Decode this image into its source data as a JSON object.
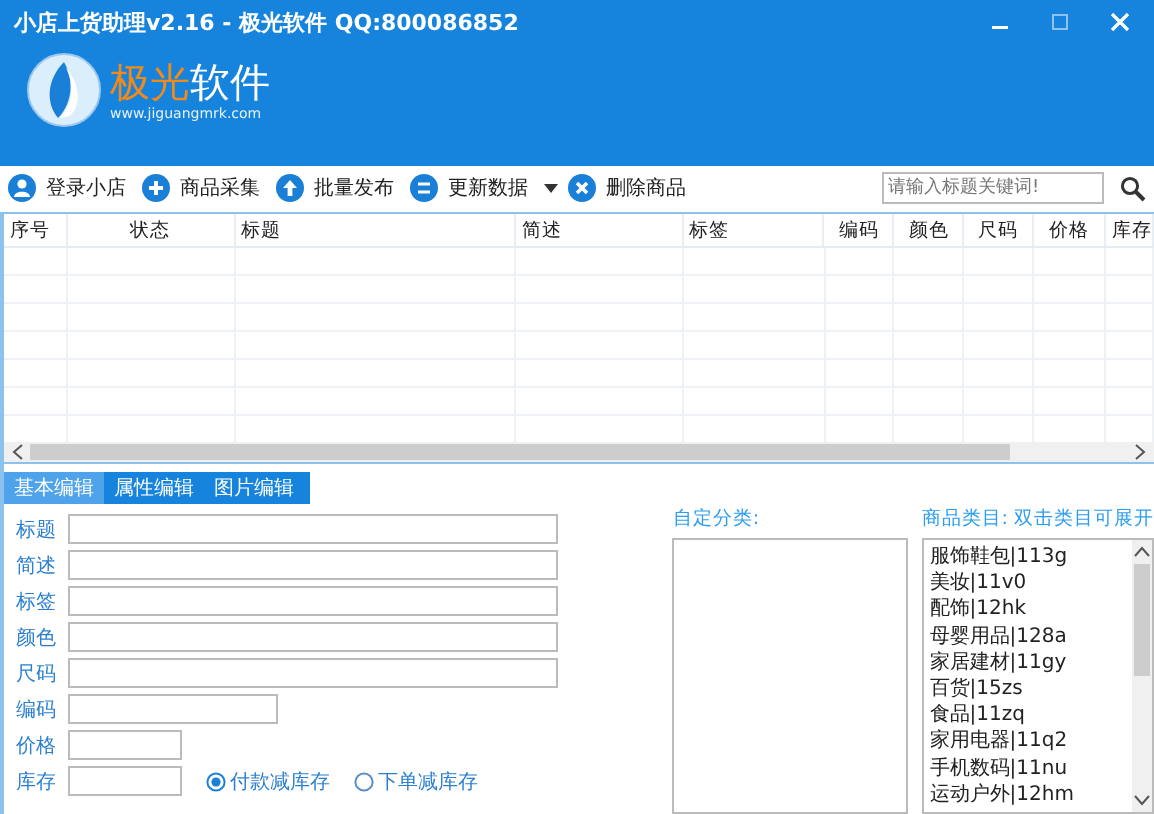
{
  "window": {
    "title": "小店上货助理v2.16 - 极光软件 QQ:800086852"
  },
  "logo": {
    "name_part1": "极光",
    "name_part2": "软件",
    "url": "www.jiguangmrk.com"
  },
  "toolbar": {
    "buttons": [
      {
        "label": "登录小店",
        "dropdown": false
      },
      {
        "label": "商品采集",
        "dropdown": false
      },
      {
        "label": "批量发布",
        "dropdown": false
      },
      {
        "label": "更新数据",
        "dropdown": true
      },
      {
        "label": "删除商品",
        "dropdown": false
      }
    ],
    "search": {
      "placeholder": "请输入标题关键词!"
    }
  },
  "table": {
    "columns": [
      "序号",
      "状态",
      "标题",
      "简述",
      "标签",
      "编码",
      "颜色",
      "尺码",
      "价格",
      "库存"
    ]
  },
  "tabs": [
    {
      "label": "基本编辑",
      "selected": true
    },
    {
      "label": "属性编辑",
      "selected": false
    },
    {
      "label": "图片编辑",
      "selected": false
    }
  ],
  "form": {
    "fields": [
      {
        "label": "标题"
      },
      {
        "label": "简述"
      },
      {
        "label": "标签"
      },
      {
        "label": "颜色"
      },
      {
        "label": "尺码"
      },
      {
        "label": "编码"
      },
      {
        "label": "价格"
      },
      {
        "label": "库存"
      }
    ],
    "stock_options": [
      {
        "label": "付款减库存",
        "selected": true
      },
      {
        "label": "下单减库存",
        "selected": false
      }
    ]
  },
  "custom_category": {
    "label": "自定分类:"
  },
  "categories": {
    "label": "商品类目: 双击类目可展开",
    "items": [
      "服饰鞋包|113g",
      "美妆|11v0",
      "配饰|12hk",
      "母婴用品|128a",
      "家居建材|11gy",
      "百货|15zs",
      "食品|11zq",
      "家用电器|11q2",
      "手机数码|11nu",
      "运动户外|12hm"
    ]
  }
}
